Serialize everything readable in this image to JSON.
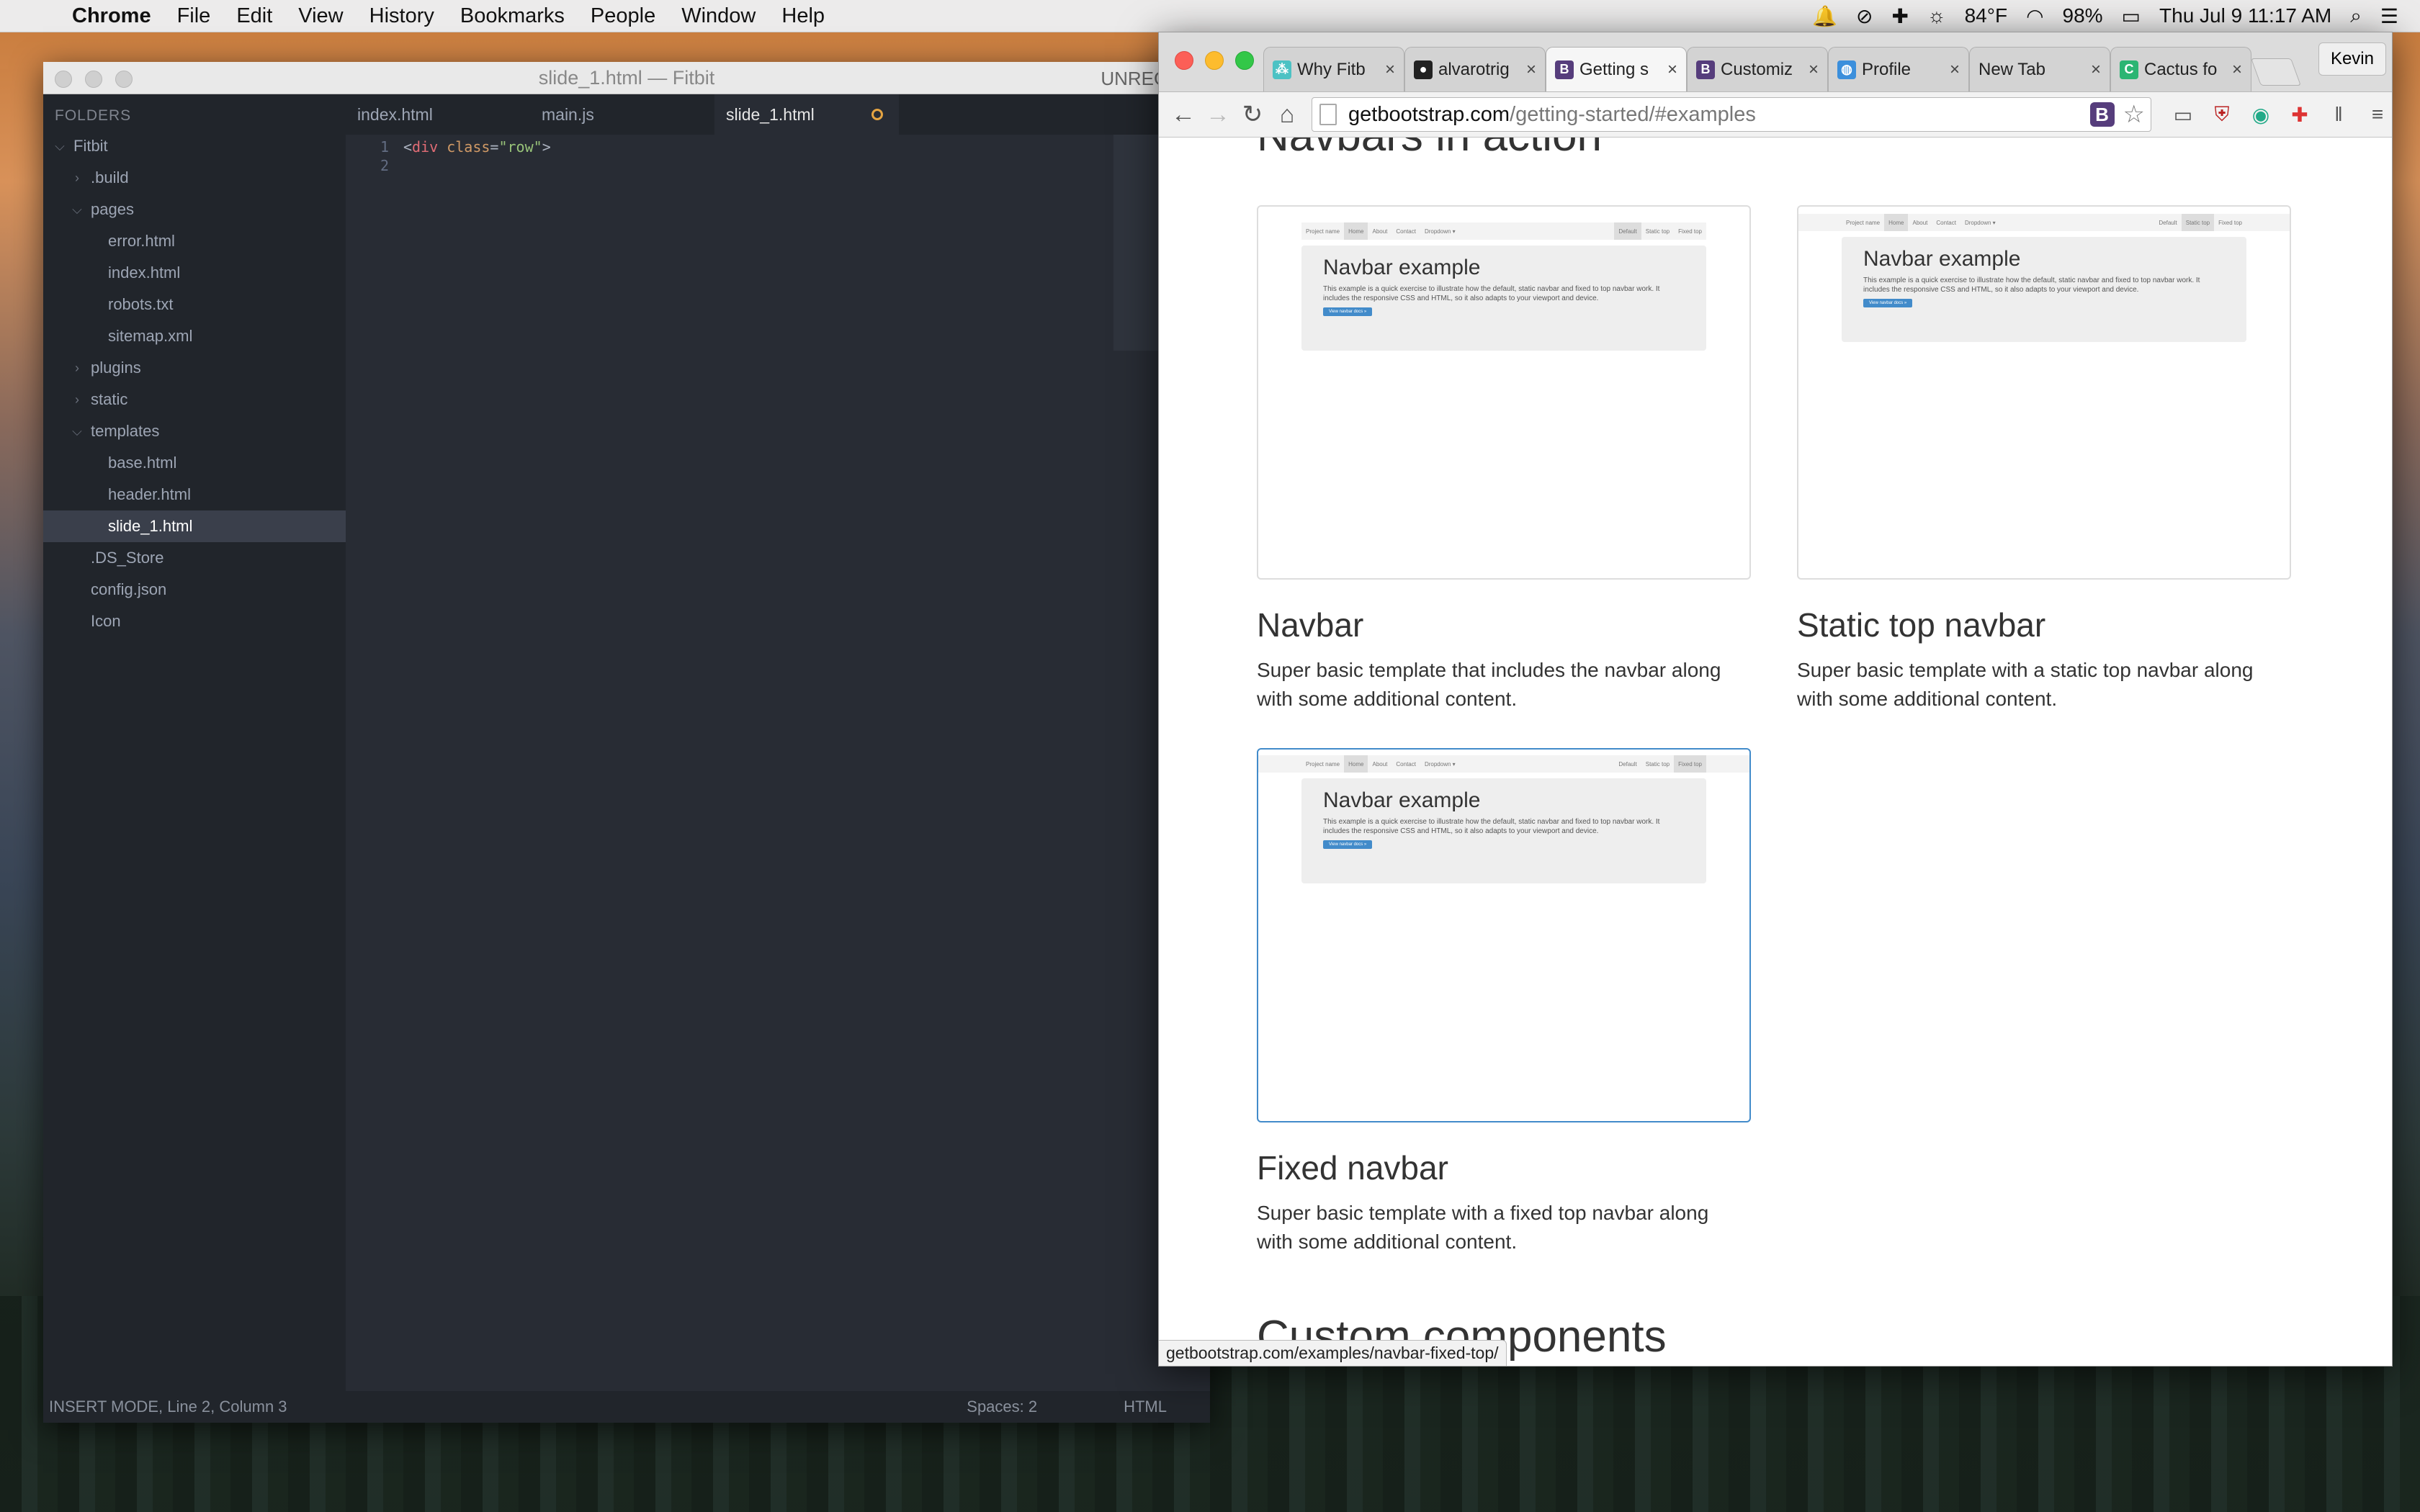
{
  "menubar": {
    "app": "Chrome",
    "items": [
      "File",
      "Edit",
      "View",
      "History",
      "Bookmarks",
      "People",
      "Window",
      "Help"
    ],
    "weather": "84°F",
    "battery": "98%",
    "datetime": "Thu Jul 9  11:17 AM"
  },
  "sublime": {
    "title": "slide_1.html — Fitbit",
    "unregistered": "UNREGISTE",
    "folders_label": "FOLDERS",
    "tree": [
      {
        "label": "Fitbit",
        "indent": 0,
        "caret": "open"
      },
      {
        "label": ".build",
        "indent": 1,
        "caret": "closed"
      },
      {
        "label": "pages",
        "indent": 1,
        "caret": "open"
      },
      {
        "label": "error.html",
        "indent": 2,
        "caret": ""
      },
      {
        "label": "index.html",
        "indent": 2,
        "caret": ""
      },
      {
        "label": "robots.txt",
        "indent": 2,
        "caret": ""
      },
      {
        "label": "sitemap.xml",
        "indent": 2,
        "caret": ""
      },
      {
        "label": "plugins",
        "indent": 1,
        "caret": "closed"
      },
      {
        "label": "static",
        "indent": 1,
        "caret": "closed"
      },
      {
        "label": "templates",
        "indent": 1,
        "caret": "open"
      },
      {
        "label": "base.html",
        "indent": 2,
        "caret": ""
      },
      {
        "label": "header.html",
        "indent": 2,
        "caret": ""
      },
      {
        "label": "slide_1.html",
        "indent": 2,
        "caret": "",
        "selected": true
      },
      {
        "label": ".DS_Store",
        "indent": 1,
        "caret": ""
      },
      {
        "label": "config.json",
        "indent": 1,
        "caret": ""
      },
      {
        "label": "Icon",
        "indent": 1,
        "caret": ""
      }
    ],
    "tabs": [
      {
        "label": "index.html"
      },
      {
        "label": "main.js"
      },
      {
        "label": "slide_1.html",
        "active": true,
        "dirty": true
      }
    ],
    "code": {
      "line1_open": "<",
      "line1_tag": "div",
      "line1_attr": " class",
      "line1_eq": "=",
      "line1_str": "\"row\"",
      "line1_close": ">",
      "gutter": [
        "1",
        "2"
      ]
    },
    "status": {
      "mode": "INSERT MODE, Line 2, Column 3",
      "spaces": "Spaces: 2",
      "syntax": "HTML"
    }
  },
  "chrome": {
    "tabs": [
      {
        "title": "Why Fitb",
        "favicon": "fitbit-icon",
        "fav_color": "#4cc2c4",
        "active": false
      },
      {
        "title": "alvarotrig",
        "favicon": "github-icon",
        "fav_color": "#222222",
        "active": false
      },
      {
        "title": "Getting s",
        "favicon": "bootstrap-icon",
        "fav_color": "#563d7c",
        "active": true
      },
      {
        "title": "Customiz",
        "favicon": "bootstrap-icon",
        "fav_color": "#563d7c",
        "active": false
      },
      {
        "title": "Profile",
        "favicon": "globe-icon",
        "fav_color": "#3b8fdc",
        "active": false
      },
      {
        "title": "New Tab",
        "favicon": "",
        "fav_color": "",
        "active": false
      },
      {
        "title": "Cactus fo",
        "favicon": "cactus-icon",
        "fav_color": "#2bb573",
        "active": false
      }
    ],
    "profile": "Kevin",
    "url_host": "getbootstrap.com",
    "url_path": "/getting-started/#examples",
    "page": {
      "section_top": "Navbars in action",
      "examples": [
        {
          "title": "Navbar",
          "desc_line1": "Super basic template that includes the navbar along",
          "desc_line2": "with some additional content."
        },
        {
          "title": "Static top navbar",
          "desc_line1": "Super basic template with a static top navbar along",
          "desc_line2": "with some additional content."
        },
        {
          "title": "Fixed navbar",
          "desc_line1": "Super basic template with a fixed top navbar along",
          "desc_line2": "with some additional content."
        }
      ],
      "thumb": {
        "project": "Project name",
        "links": [
          "Home",
          "About",
          "Contact",
          "Dropdown ▾"
        ],
        "right_links": [
          "Default",
          "Static top",
          "Fixed top"
        ],
        "heading": "Navbar example",
        "text": "This example is a quick exercise to illustrate how the default, static navbar and fixed to top navbar work. It includes the responsive CSS and HTML, so it also adapts to your viewport and device.",
        "button": "View navbar docs »"
      },
      "section_next": "Custom components"
    },
    "status_url": "getbootstrap.com/examples/navbar-fixed-top/"
  }
}
